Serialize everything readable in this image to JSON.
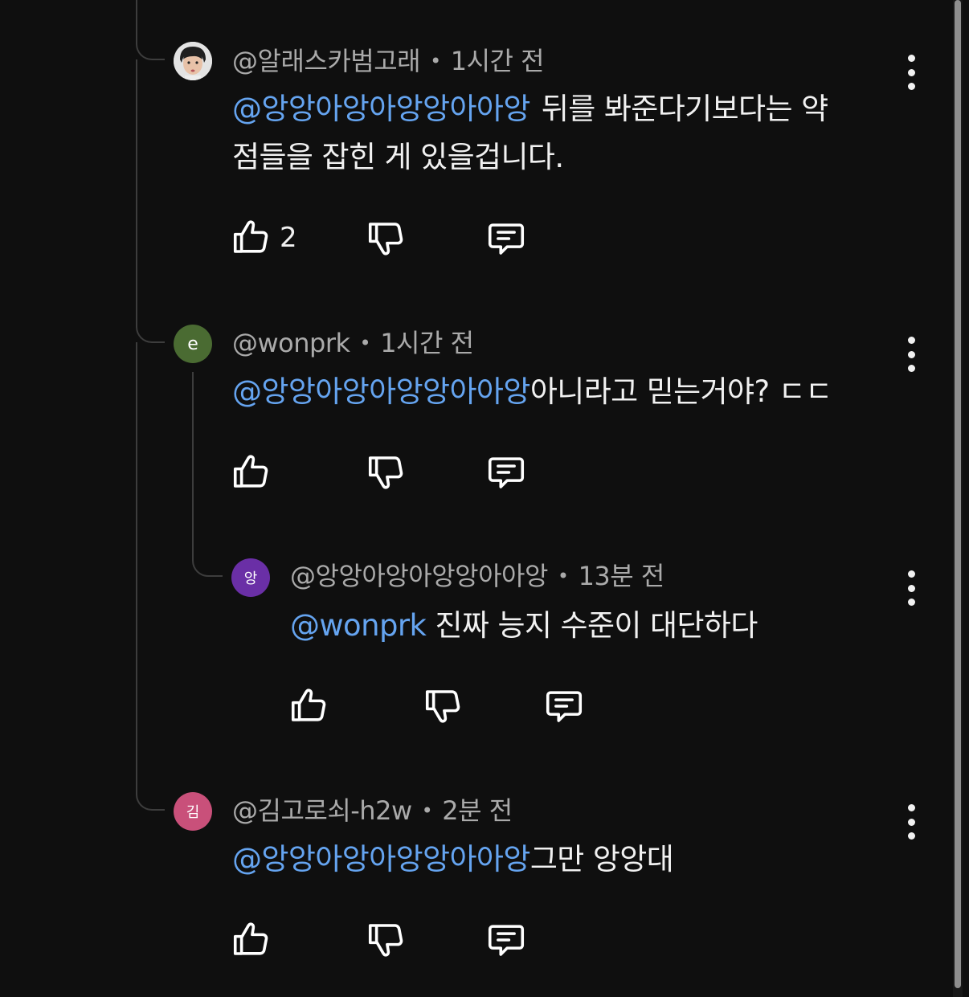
{
  "comments": [
    {
      "author": "@알래스카범고래",
      "time": "1시간 전",
      "mention": "@앙앙아앙아앙앙아아앙",
      "text_line1": "뒤를 봐준다기보다는  약",
      "text_line2": "점들을  잡힌 게 있을겁니다.",
      "likes": "2",
      "avatar_color": "#d9d9d9"
    },
    {
      "author": "@wonprk",
      "time": "1시간 전",
      "avatar_letter": "e",
      "mention": "@앙앙아앙아앙앙아아앙",
      "text": "아니라고 믿는거야? ㄷㄷ",
      "avatar_color": "#4a6b32"
    },
    {
      "author": "@앙앙아앙아앙앙아아앙",
      "time": "13분 전",
      "avatar_letter": "앙",
      "mention": "@wonprk",
      "text": " 진짜 능지 수준이 대단하다",
      "avatar_color": "#6a2fa6"
    },
    {
      "author": "@김고로쇠-h2w",
      "time": "2분 전",
      "avatar_letter": "김",
      "mention": "@앙앙아앙아앙앙아아앙",
      "text": "그만 앙앙대",
      "avatar_color": "#c9507a"
    }
  ],
  "icons": {
    "like": "thumbs-up-icon",
    "dislike": "thumbs-down-icon",
    "reply": "reply-comment-icon",
    "menu": "more-vertical-icon"
  },
  "colors": {
    "background": "#0f0f0f",
    "mention": "#65a4f0",
    "meta": "#aaaaaa"
  }
}
